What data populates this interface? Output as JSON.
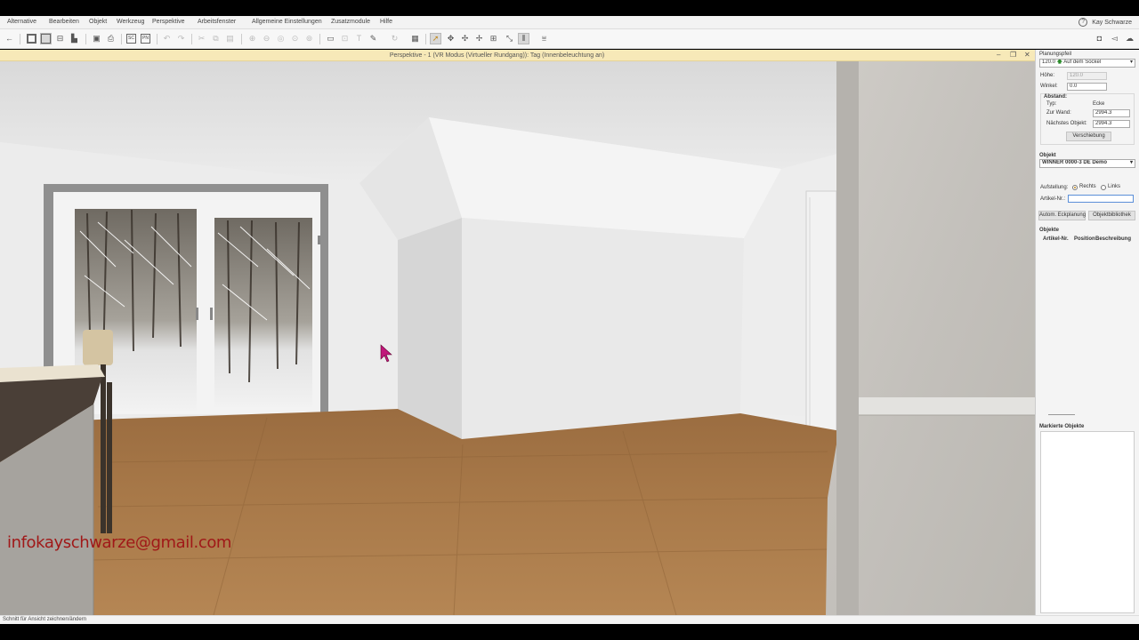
{
  "menu": {
    "items": [
      "Alternative",
      "Bearbeiten",
      "Objekt",
      "Werkzeug",
      "Perspektive",
      "Arbeitsfenster",
      "Allgemeine Einstellungen",
      "Zusatzmodule",
      "Hilfe"
    ],
    "user": "Kay Schwarze"
  },
  "toolbar": {
    "icons": [
      "back-icon",
      "floorplan-icon",
      "elevation-icon",
      "section-icon",
      "bar-chart-icon",
      "save-icon",
      "print-icon",
      "sc-icon",
      "pn-icon",
      "undo-icon",
      "redo-icon",
      "cut-icon",
      "copy-icon",
      "paste-icon",
      "zoom-in-icon",
      "zoom-out-icon",
      "zoom-window-icon",
      "zoom-fit-icon",
      "zoom-all-icon",
      "note-icon",
      "dimension-icon",
      "text-icon",
      "edit-icon",
      "calculator-icon",
      "refresh-icon",
      "select-arrow-icon",
      "move-icon",
      "rotate-icon",
      "snap-icon",
      "grid-icon",
      "measure-icon",
      "columns-icon",
      "layer-icon",
      "camera-icon",
      "megaphone-icon",
      "cloud-icon"
    ],
    "sc_label": "SC",
    "pn_label": "PN"
  },
  "viewport": {
    "title": "Perspektive - 1 (VR Modus (Virtueller Rundgang)): Tag (Innenbeleuchtung an)"
  },
  "panel": {
    "planning_arrow_label": "Planungspfeil",
    "height_value": "120.0",
    "height_mode": "Auf dem Sockel",
    "hoehe_label": "Höhe:",
    "hoehe_value": "120.0",
    "winkel_label": "Winkel:",
    "winkel_value": "0.0",
    "abstand_label": "Abstand:",
    "typ_label": "Typ:",
    "typ_value": "Ecke",
    "zur_wand_label": "Zur Wand:",
    "zur_wand_value": "2994.3",
    "naechstes_label": "Nächstes Objekt:",
    "naechstes_value": "2994.3",
    "verschiebung_button": "Verschiebung",
    "objekt_label": "Objekt",
    "objekt_value": "WINNER 0000-3 DE Demo",
    "aufstellung_label": "Aufstellung:",
    "rechts_label": "Rechts",
    "links_label": "Links",
    "artikel_label": "Artikel-Nr.:",
    "artikel_value": "",
    "autom_button": "Autom. Eckplanung",
    "bibliothek_button": "Objektbibliothek",
    "objekte_label": "Objekte",
    "columns": [
      "Artikel-Nr.",
      "Position",
      "Beschreibung"
    ],
    "markierte_label": "Markierte Objekte"
  },
  "overlay": {
    "email": "infokayschwarze@gmail.com"
  },
  "status": {
    "text": "Schnitt für Ansicht zeichnen/ändern"
  },
  "colors": {
    "title_bar": "#f7e9b8",
    "floor": "#a77848",
    "wall": "#ececec",
    "cursor": "#c0187a",
    "email": "#a01818"
  }
}
